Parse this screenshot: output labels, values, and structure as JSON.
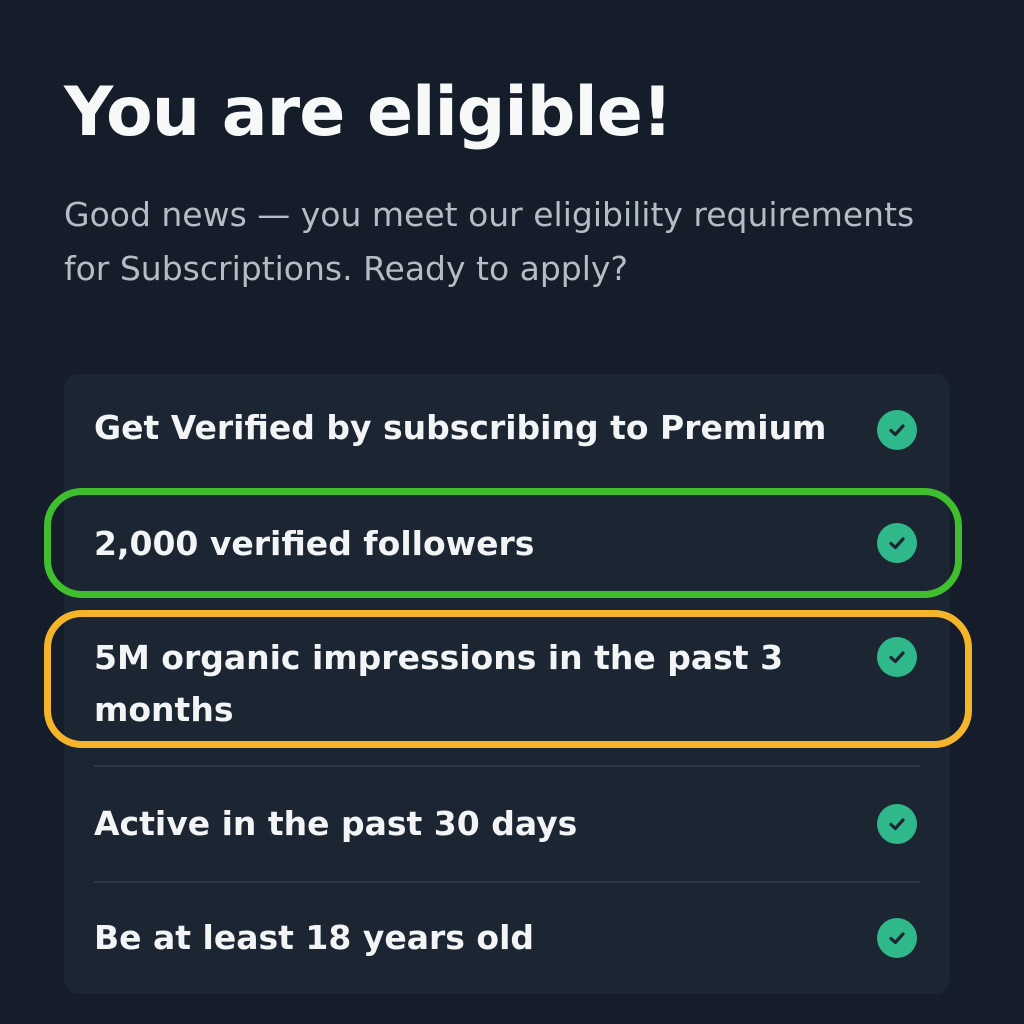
{
  "header": {
    "title": "You are eligible!",
    "subtitle": "Good news — you meet our eligibility requirements for Subscriptions. Ready to apply?"
  },
  "requirements": [
    {
      "label": "Get Verified by subscribing to Premium",
      "met": true,
      "icon": "check-circle-icon"
    },
    {
      "label": "2,000 verified followers",
      "met": true,
      "icon": "check-circle-icon",
      "highlight": "#3fbe2e"
    },
    {
      "label": "5M organic impressions in the past 3 months",
      "met": true,
      "icon": "check-circle-icon",
      "highlight": "#f4b52b"
    },
    {
      "label": "Active in the past 30 days",
      "met": true,
      "icon": "check-circle-icon"
    },
    {
      "label": "Be at least 18 years old",
      "met": true,
      "icon": "check-circle-icon"
    }
  ],
  "colors": {
    "background": "#141d29",
    "card": "#1c2633",
    "check": "#2fb98a",
    "highlight_green": "#3fbe2e",
    "highlight_yellow": "#f4b52b"
  }
}
